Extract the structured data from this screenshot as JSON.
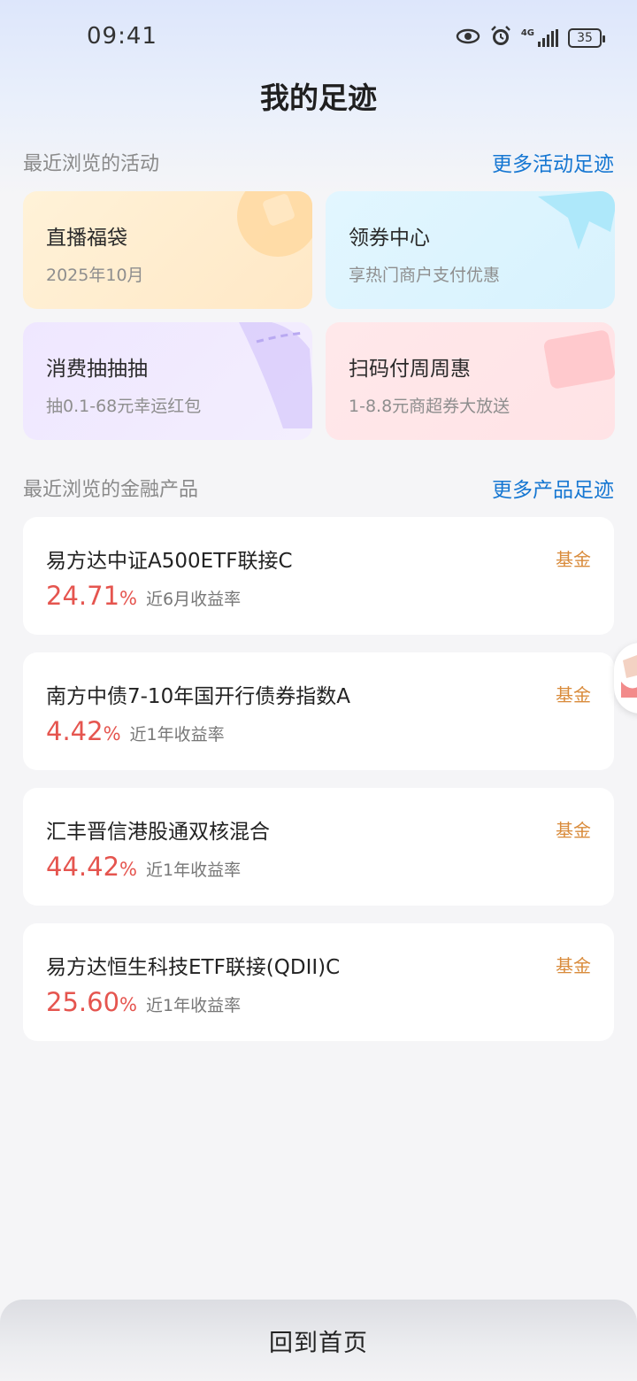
{
  "status_bar": {
    "time": "09:41",
    "network": "4G",
    "battery": "35",
    "icons": [
      "eye-icon",
      "alarm-icon",
      "signal-icon",
      "battery-icon"
    ]
  },
  "header": {
    "title": "我的足迹"
  },
  "activities": {
    "title": "最近浏览的活动",
    "more_link": "更多活动足迹",
    "items": [
      {
        "title": "直播福袋",
        "subtitle": "2025年10月",
        "accent": "#ffd9a1"
      },
      {
        "title": "领券中心",
        "subtitle": "享热门商户支付优惠",
        "accent": "#9fe4f8"
      },
      {
        "title": "消费抽抽抽",
        "subtitle": "抽0.1-68元幸运红包",
        "accent": "#d8ccfb"
      },
      {
        "title": "扫码付周周惠",
        "subtitle": "1-8.8元商超券大放送",
        "accent": "#ffc4c8"
      }
    ]
  },
  "products": {
    "title": "最近浏览的金融产品",
    "more_link": "更多产品足迹",
    "items": [
      {
        "name": "易方达中证A500ETF联接C",
        "tag": "基金",
        "rate": "24.71",
        "pct": "%",
        "rate_label": "近6月收益率"
      },
      {
        "name": "南方中债7-10年国开行债券指数A",
        "tag": "基金",
        "rate": "4.42",
        "pct": "%",
        "rate_label": "近1年收益率"
      },
      {
        "name": "汇丰晋信港股通双核混合",
        "tag": "基金",
        "rate": "44.42",
        "pct": "%",
        "rate_label": "近1年收益率"
      },
      {
        "name": "易方达恒生科技ETF联接(QDII)C",
        "tag": "基金",
        "rate": "25.60",
        "pct": "%",
        "rate_label": "近1年收益率"
      }
    ]
  },
  "bottom": {
    "label": "回到首页"
  },
  "colors": {
    "link": "#1677d2",
    "rate": "#e5554f",
    "tag": "#d98b3b"
  }
}
